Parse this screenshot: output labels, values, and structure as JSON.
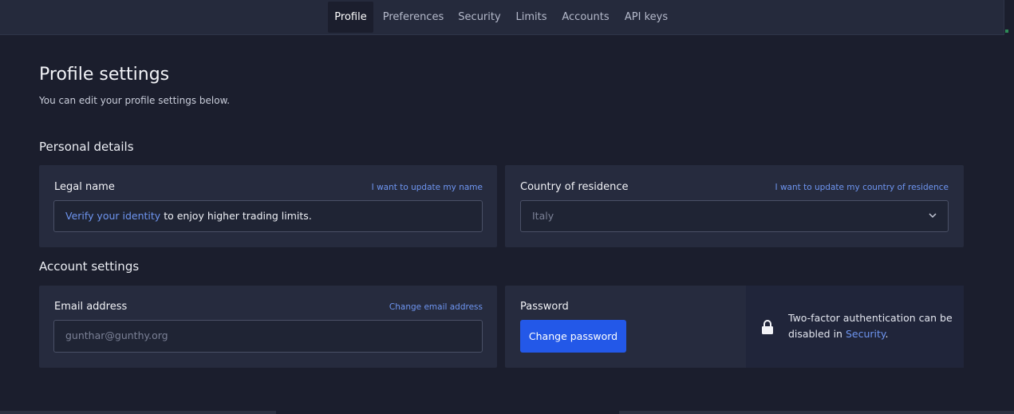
{
  "nav": {
    "tabs": [
      {
        "label": "Profile",
        "active": true
      },
      {
        "label": "Preferences",
        "active": false
      },
      {
        "label": "Security",
        "active": false
      },
      {
        "label": "Limits",
        "active": false
      },
      {
        "label": "Accounts",
        "active": false
      },
      {
        "label": "API keys",
        "active": false
      }
    ]
  },
  "page": {
    "title": "Profile settings",
    "subtitle": "You can edit your profile settings below."
  },
  "personal": {
    "heading": "Personal details",
    "legal_name": {
      "label": "Legal name",
      "link": "I want to update my name",
      "verify_link": "Verify your identity",
      "verify_rest": " to enjoy higher trading limits."
    },
    "country": {
      "label": "Country of residence",
      "link": "I want to update my country of residence",
      "value": "Italy"
    }
  },
  "account": {
    "heading": "Account settings",
    "email": {
      "label": "Email address",
      "link": "Change email address",
      "value": "gunthar@gunthy.org"
    },
    "password": {
      "label": "Password",
      "button": "Change password"
    },
    "twofa": {
      "text_before": "Two-factor authentication can be disabled in ",
      "link": "Security",
      "text_after": "."
    }
  },
  "colors": {
    "background": "#1b1e2d",
    "card": "#262b3e",
    "accent_link": "#6e95f0",
    "primary_button": "#2358e8"
  }
}
